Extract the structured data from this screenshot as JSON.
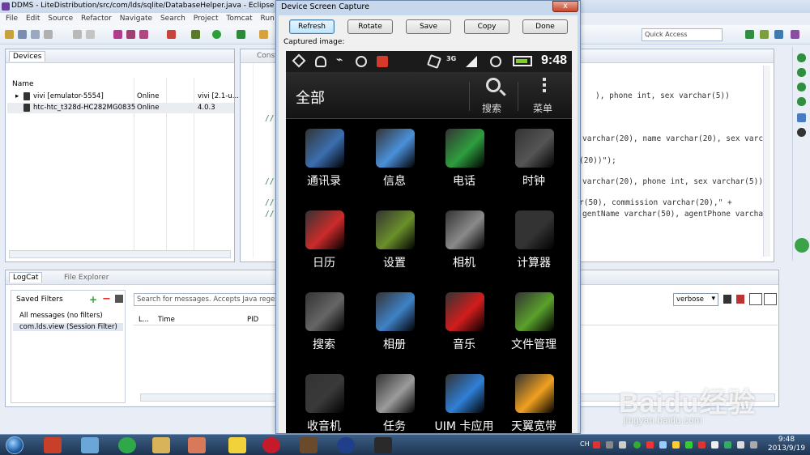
{
  "eclipse": {
    "title": "DDMS - LiteDistribution/src/com/lds/sqlite/DatabaseHelper.java - Eclipse",
    "menu": [
      "File",
      "Edit",
      "Source",
      "Refactor",
      "Navigate",
      "Search",
      "Project",
      "Tomcat",
      "Run"
    ],
    "quick_access": "Quick Access",
    "devices": {
      "tab_label": "Devices",
      "col_name": "Name",
      "rows": [
        {
          "name": "vivi [emulator-5554]",
          "status": "Online",
          "extra": "vivi [2.1-u..."
        },
        {
          "name": "htc-htc_t328d-HC282MG0835",
          "status": "Online",
          "extra": "4.0.3"
        }
      ]
    },
    "editor": {
      "tab_label": "Const",
      "lines": [
        {
          "text": "), phone int, sex varchar(5))",
          "kind": "code"
        },
        {
          "text": "//",
          "kind": "comment"
        },
        {
          "text": "varchar(20), name varchar(20), sex varc",
          "kind": "code"
        },
        {
          "text": "(20))\");",
          "kind": "code"
        },
        {
          "text": "//",
          "kind": "comment"
        },
        {
          "text": "varchar(20), phone int, sex varchar(5))",
          "kind": "code"
        },
        {
          "text": "//",
          "kind": "comment"
        },
        {
          "text": "r(50), commission varchar(20),\" +",
          "kind": "code"
        },
        {
          "text": "//",
          "kind": "comment"
        },
        {
          "text": "gentName varchar(50), agentPhone varcha",
          "kind": "code"
        }
      ]
    },
    "logcat": {
      "tab_logcat": "LogCat",
      "tab_file_explorer": "File Explorer",
      "saved_filters": "Saved Filters",
      "filters": [
        "All messages (no filters)",
        "com.lds.view (Session Filter)"
      ],
      "search_placeholder": "Search for messages. Accepts Java regex",
      "level": "verbose",
      "columns": [
        "L...",
        "Time",
        "PID"
      ]
    }
  },
  "dialog": {
    "title": "Device Screen Capture",
    "close": "x",
    "buttons": [
      "Refresh",
      "Rotate",
      "Save",
      "Copy",
      "Done"
    ],
    "captured_label": "Captured image:"
  },
  "phone": {
    "clock": "9:48",
    "signal_label": "3G",
    "appbar_title": "全部",
    "search_label": "搜索",
    "menu_label": "菜单",
    "apps": [
      {
        "label": "通讯录",
        "icon": "contacts-icon",
        "color": "#3b6fb0"
      },
      {
        "label": "信息",
        "icon": "messages-icon",
        "color": "#4a90d9"
      },
      {
        "label": "电话",
        "icon": "phone-icon",
        "color": "#2e9e3e"
      },
      {
        "label": "时钟",
        "icon": "clock-icon",
        "color": "#555555"
      },
      {
        "label": "日历",
        "icon": "calendar-icon",
        "color": "#cc2b2b"
      },
      {
        "label": "设置",
        "icon": "settings-icon",
        "color": "#6a8f2a"
      },
      {
        "label": "相机",
        "icon": "camera-icon",
        "color": "#8a8a8a"
      },
      {
        "label": "计算器",
        "icon": "calculator-icon",
        "color": "#333333"
      },
      {
        "label": "搜索",
        "icon": "search-icon",
        "color": "#666666"
      },
      {
        "label": "相册",
        "icon": "gallery-icon",
        "color": "#3f82c7"
      },
      {
        "label": "音乐",
        "icon": "music-icon",
        "color": "#d21d1d"
      },
      {
        "label": "文件管理",
        "icon": "folder-icon",
        "color": "#5aa02c"
      },
      {
        "label": "收音机",
        "icon": "radio-icon",
        "color": "#3a3a3a"
      },
      {
        "label": "任务",
        "icon": "tasks-icon",
        "color": "#9b9b9b"
      },
      {
        "label": "UIM 卡应用",
        "icon": "sim-app-icon",
        "color": "#2f7fd6"
      },
      {
        "label": "天翼宽带",
        "icon": "wifi-icon",
        "color": "#f0a020"
      }
    ]
  },
  "taskbar": {
    "input_lang": "CH",
    "time": "9:48",
    "date": "2013/9/19"
  },
  "watermark": {
    "logo": "Baidu经验",
    "url": "jingyan.baidu.com"
  }
}
